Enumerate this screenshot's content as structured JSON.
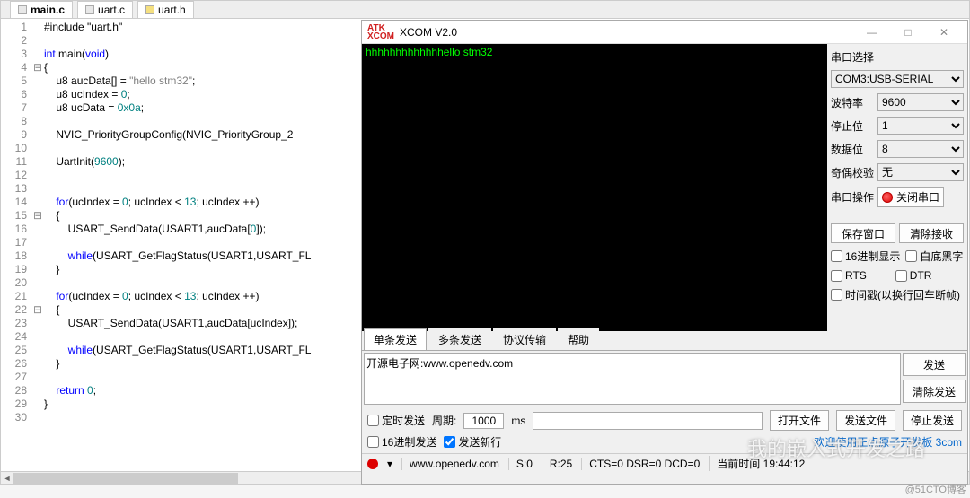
{
  "tabs": {
    "t0": "main.c",
    "t1": "uart.c",
    "t2": "uart.h"
  },
  "code": {
    "l1": "#include \"uart.h\"",
    "l3a": "int",
    "l3b": " main(",
    "l3c": "void",
    "l3d": ")",
    "l5a": "    u8 aucData[] = ",
    "l5b": "\"hello stm32\"",
    "l5c": ";",
    "l6a": "    u8 ucIndex = ",
    "l6b": "0",
    "l6c": ";",
    "l7a": "    u8 ucData = ",
    "l7b": "0x0a",
    "l7c": ";",
    "l9": "    NVIC_PriorityGroupConfig(NVIC_PriorityGroup_2",
    "l11a": "    UartInit(",
    "l11b": "9600",
    "l11c": ");",
    "l14a": "    for",
    "l14b": "(ucIndex = ",
    "l14c": "0",
    "l14d": "; ucIndex < ",
    "l14e": "13",
    "l14f": "; ucIndex ++)",
    "l15": "    {",
    "l16a": "        USART_SendData(USART1,aucData[",
    "l16b": "0",
    "l16c": "]);",
    "l18a": "        while",
    "l18b": "(USART_GetFlagStatus(USART1,USART_FL",
    "l19": "    }",
    "l21a": "    for",
    "l21b": "(ucIndex = ",
    "l21c": "0",
    "l21d": "; ucIndex < ",
    "l21e": "13",
    "l21f": "; ucIndex ++)",
    "l22": "    {",
    "l23": "        USART_SendData(USART1,aucData[ucIndex]);",
    "l25a": "        while",
    "l25b": "(USART_GetFlagStatus(USART1,USART_FL",
    "l26": "    }",
    "l28a": "    return ",
    "l28b": "0",
    "l28c": ";",
    "l29": "}"
  },
  "lines": [
    "1",
    "2",
    "3",
    "4",
    "5",
    "6",
    "7",
    "8",
    "9",
    "10",
    "11",
    "12",
    "13",
    "14",
    "15",
    "16",
    "17",
    "18",
    "19",
    "20",
    "21",
    "22",
    "23",
    "24",
    "25",
    "26",
    "27",
    "28",
    "29",
    "30"
  ],
  "xcom": {
    "title": "XCOM V2.0",
    "term": "hhhhhhhhhhhhhello stm32",
    "r": {
      "port_lbl": "串口选择",
      "port": "COM3:USB-SERIAL",
      "baud_lbl": "波特率",
      "baud": "9600",
      "stop_lbl": "停止位",
      "stop": "1",
      "data_lbl": "数据位",
      "data": "8",
      "parity_lbl": "奇偶校验",
      "parity": "无",
      "op_lbl": "串口操作",
      "op_btn": "关闭串口",
      "save": "保存窗口",
      "clear": "清除接收",
      "hex": "16进制显示",
      "bw": "白底黑字",
      "rts": "RTS",
      "dtr": "DTR",
      "ts": "时间戳(以换行回车断帧)"
    },
    "tabs": {
      "t0": "单条发送",
      "t1": "多条发送",
      "t2": "协议传输",
      "t3": "帮助"
    },
    "sendtext": "开源电子网:www.openedv.com",
    "send": "发送",
    "clrsend": "清除发送",
    "timed": "定时发送",
    "period_lbl": "周期:",
    "period": "1000",
    "ms": "ms",
    "open": "打开文件",
    "sendfile": "发送文件",
    "stopsend": "停止发送",
    "hexsend": "16进制发送",
    "newline": "发送新行",
    "status": {
      "url": "www.openedv.com",
      "s": "S:0",
      "r": "R:25",
      "cts": "CTS=0 DSR=0 DCD=0",
      "time_lbl": "当前时间",
      "time": "19:44:12"
    }
  },
  "watermark": "我的嵌入式开发之路",
  "credit": "@51CTO博客"
}
